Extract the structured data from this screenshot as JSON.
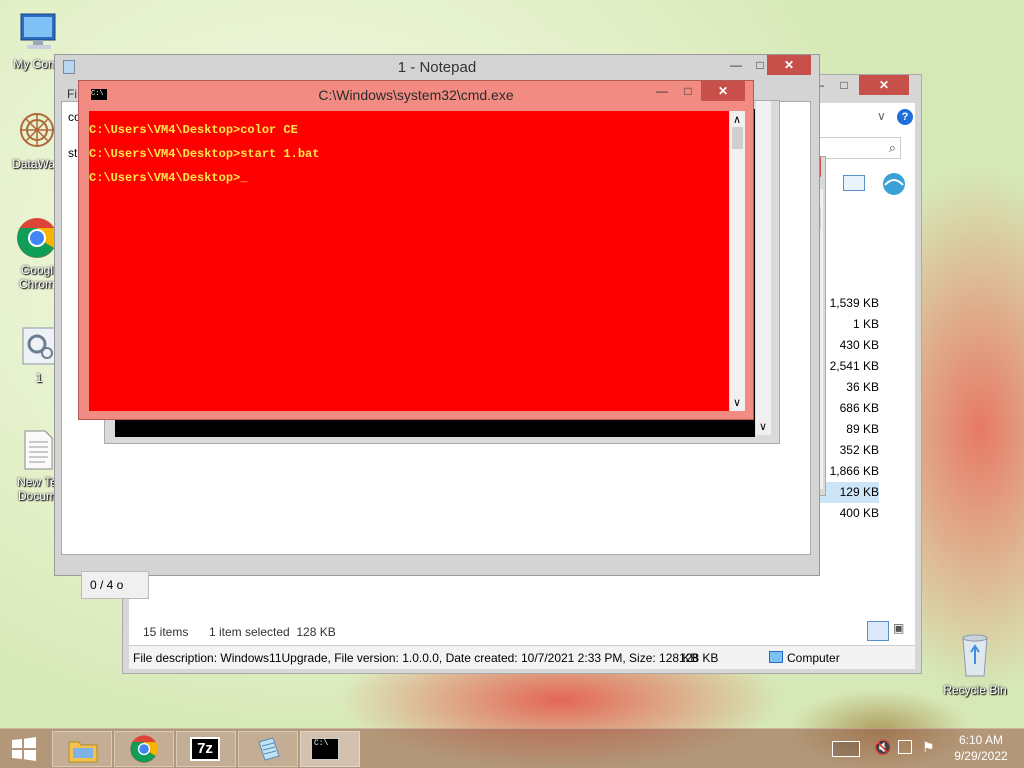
{
  "desktop": {
    "icons": [
      {
        "label": "My Comp",
        "label2": ""
      },
      {
        "label": "DataWag",
        "label2": ""
      },
      {
        "label": "Googl",
        "label2": "Chrom"
      },
      {
        "label": "1",
        "label2": ""
      },
      {
        "label": "New Te",
        "label2": "Docum"
      },
      {
        "label": "Recycle Bin",
        "label2": ""
      }
    ]
  },
  "explorer": {
    "sizes": [
      "1,539 KB",
      "1 KB",
      "430 KB",
      "2,541 KB",
      "36 KB",
      "686 KB",
      "89 KB",
      "352 KB",
      "1,866 KB",
      "129 KB",
      "400 KB"
    ],
    "selected_index": 9,
    "status_items": "15 items",
    "status_selected": "1 item selected  128 KB",
    "details": "File description: Windows11Upgrade, File version: 1.0.0.0, Date created: 10/7/2021 2:33 PM, Size: 128 KB",
    "details_size": "128 KB",
    "details_location": "Computer",
    "help_icon": "?"
  },
  "notepad": {
    "title": "1 - Notepad",
    "menu_stub": "Fi",
    "text_line1": "co",
    "text_line2": "st",
    "status": "0 / 4 o"
  },
  "cmd": {
    "title": "C:\\Windows\\system32\\cmd.exe",
    "icon_text": "C:\\",
    "lines": [
      "C:\\Users\\VM4\\Desktop>color CE",
      "C:\\Users\\VM4\\Desktop>start 1.bat",
      "C:\\Users\\VM4\\Desktop>_"
    ],
    "colors": {
      "background": "#ff0000",
      "foreground": "#ffe64a"
    }
  },
  "taskbar": {
    "items": [
      "start-button",
      "file-explorer",
      "chrome",
      "7-zip",
      "notepad",
      "command-prompt"
    ],
    "seven_zip_label": "7z",
    "time": "6:10 AM",
    "date": "9/29/2022"
  }
}
